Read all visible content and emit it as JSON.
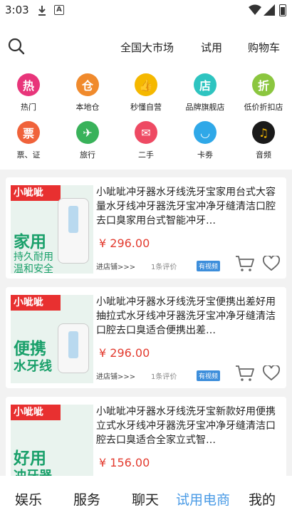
{
  "status": {
    "time": "3:03"
  },
  "topnav": {
    "tabs": [
      "全国大市场",
      "试用",
      "购物车"
    ]
  },
  "categories": [
    {
      "label": "热门",
      "glyph": "热",
      "color": "#e8357a",
      "icon": "hot-icon"
    },
    {
      "label": "本地仓",
      "glyph": "仓",
      "color": "#f08a2c",
      "icon": "gift-icon"
    },
    {
      "label": "秒懂自营",
      "glyph": "👍",
      "color": "#f5b800",
      "icon": "thumbs-up-icon"
    },
    {
      "label": "品牌旗舰店",
      "glyph": "店",
      "color": "#2ec4c0",
      "icon": "store-icon"
    },
    {
      "label": "低价折扣店",
      "glyph": "折",
      "color": "#8bc63f",
      "icon": "discount-icon"
    },
    {
      "label": "票、证",
      "glyph": "票",
      "color": "#f0623a",
      "icon": "bus-icon"
    },
    {
      "label": "旅行",
      "glyph": "✈",
      "color": "#39b25a",
      "icon": "plane-icon"
    },
    {
      "label": "二手",
      "glyph": "✉",
      "color": "#ee4a63",
      "icon": "paper-plane-icon"
    },
    {
      "label": "卡劵",
      "glyph": "◡",
      "color": "#2fa8e8",
      "icon": "card-icon"
    },
    {
      "label": "音频",
      "glyph": "♫",
      "color": "#1a1a1a",
      "icon": "music-icon"
    }
  ],
  "products": [
    {
      "title": "小呲呲冲牙器水牙线洗牙宝家用台式大容量水牙线冲牙器洗牙宝冲净牙缝清洁口腔去口臭家用台式智能冲牙…",
      "price": "¥ 296.00",
      "shop": "进店铺>>>",
      "reviews": "1条评价",
      "badge": "有视频",
      "thumb_brand": "小呲呲",
      "thumb_big": "家用",
      "thumb_small1": "持久耐用",
      "thumb_small2": "温和安全"
    },
    {
      "title": "小呲呲冲牙器水牙线洗牙宝便携出差好用抽拉式水牙线冲牙器洗牙宝冲净牙缝清洁口腔去口臭适合便携出差…",
      "price": "¥ 296.00",
      "shop": "进店铺>>>",
      "reviews": "1条评价",
      "badge": "有视频",
      "thumb_brand": "小呲呲",
      "thumb_big": "便携",
      "thumb_small1": "水牙线",
      "thumb_small2": ""
    },
    {
      "title": "小呲呲冲牙器水牙线洗牙宝新款好用便携立式水牙线冲牙器洗牙宝冲净牙缝清洁口腔去口臭适合全家立式智…",
      "price": "¥ 156.00",
      "shop": "",
      "reviews": "",
      "badge": "",
      "thumb_brand": "小呲呲",
      "thumb_big": "好用",
      "thumb_small1": "冲牙器",
      "thumb_small2": ""
    }
  ],
  "bottomnav": {
    "items": [
      "娱乐",
      "服务",
      "聊天",
      "试用电商",
      "我的"
    ],
    "active_color": "#4a9be6"
  }
}
